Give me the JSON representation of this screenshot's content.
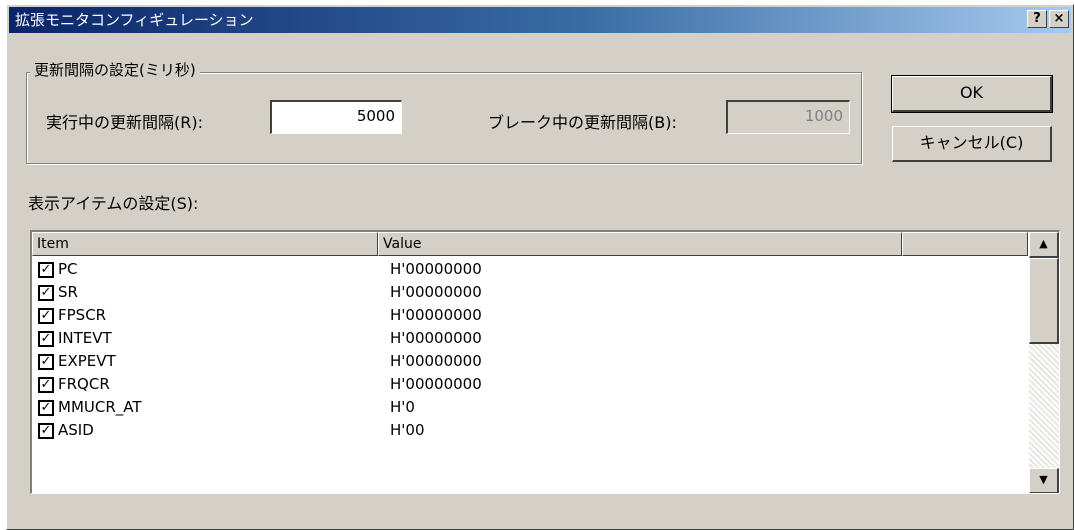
{
  "window": {
    "title": "拡張モニタコンフィギュレーション",
    "help_icon": "?",
    "close_icon": "×"
  },
  "update_group": {
    "legend": "更新間隔の設定(ミリ秒)",
    "run_label": "実行中の更新間隔(R):",
    "run_value": "5000",
    "break_label": "ブレーク中の更新間隔(B):",
    "break_value": "1000"
  },
  "buttons": {
    "ok": "OK",
    "cancel": "キャンセル(C)"
  },
  "items_section": {
    "label": "表示アイテムの設定(S):",
    "columns": [
      "Item",
      "Value",
      ""
    ],
    "rows": [
      {
        "name": "PC",
        "value": "H'00000000",
        "checked": true
      },
      {
        "name": "SR",
        "value": "H'00000000",
        "checked": true
      },
      {
        "name": "FPSCR",
        "value": "H'00000000",
        "checked": true
      },
      {
        "name": "INTEVT",
        "value": "H'00000000",
        "checked": true
      },
      {
        "name": "EXPEVT",
        "value": "H'00000000",
        "checked": true
      },
      {
        "name": "FRQCR",
        "value": "H'00000000",
        "checked": true
      },
      {
        "name": "MMUCR_AT",
        "value": "H'0",
        "checked": true
      },
      {
        "name": "ASID",
        "value": "H'00",
        "checked": true
      }
    ]
  },
  "scrollbar": {
    "up_icon": "▲",
    "down_icon": "▼"
  }
}
